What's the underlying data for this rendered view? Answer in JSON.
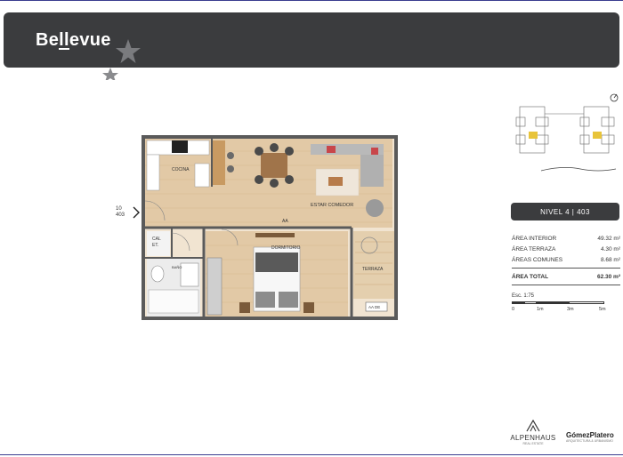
{
  "header": {
    "logo_text_a": "Be",
    "logo_text_u": "ll",
    "logo_text_b": "evue"
  },
  "plan": {
    "rooms": {
      "kitchen": "COCINA",
      "living": "ESTAR COMEDOR",
      "bedroom": "DORMITORIO",
      "terrace": "TERRAZA",
      "laundry_top": "CAL",
      "laundry_bottom": "ET."
    },
    "labels": {
      "aa": "AA",
      "aa_de": "AA DE",
      "bano": "BAÑO"
    },
    "entry": "10\n403"
  },
  "unit": {
    "nivel_label": "NIVEL 4 | 403"
  },
  "areas": [
    {
      "label": "ÁREA INTERIOR",
      "value": "49.32 m²"
    },
    {
      "label": "ÁREA TERRAZA",
      "value": "4.30 m²"
    },
    {
      "label": "ÁREAS COMUNES",
      "value": "8.68 m²"
    }
  ],
  "area_total": {
    "label": "ÁREA TOTAL",
    "value": "62.30 m²"
  },
  "scale": {
    "title": "Esc. 1:75",
    "ticks": [
      "0",
      "1m",
      "3m",
      "5m"
    ]
  },
  "brands": {
    "alpenhaus": "ALPENHAUS",
    "alpenhaus_sub": "REAL ESTATE",
    "gomez": "GómezPlatero",
    "gomez_sub": "ARQUITECTURA & URBANISMO"
  },
  "colors": {
    "header_bg": "#3b3c3e",
    "wood": "#e2c9a6",
    "wall": "#5a5a5a",
    "highlight": "#e8c43a",
    "rule": "#3a3d8f"
  }
}
